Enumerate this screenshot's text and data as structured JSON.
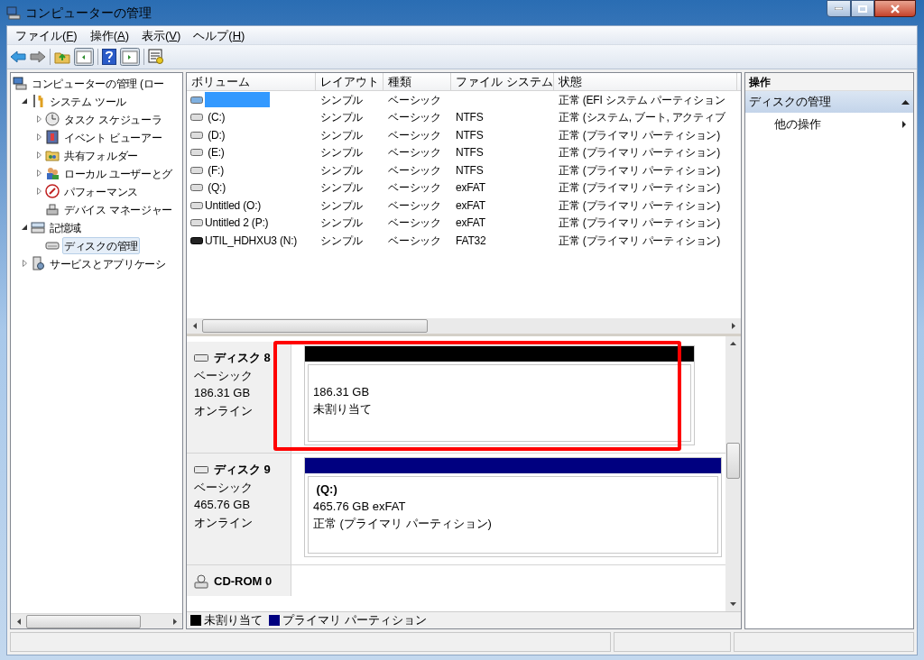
{
  "window": {
    "title": "コンピューターの管理"
  },
  "menu": [
    "ファイル(F)",
    "操作(A)",
    "表示(V)",
    "ヘルプ(H)"
  ],
  "tree": [
    {
      "label": "コンピューターの管理 (ロー",
      "selected": false,
      "children": [
        {
          "label": "システム ツール",
          "expanded": true,
          "selected": false,
          "children": [
            {
              "label": "タスク スケジューラ",
              "expanded": false,
              "selected": false
            },
            {
              "label": "イベント ビューアー",
              "expanded": false,
              "selected": false
            },
            {
              "label": "共有フォルダー",
              "expanded": false,
              "selected": false
            },
            {
              "label": "ローカル ユーザーとグ",
              "expanded": false,
              "selected": false
            },
            {
              "label": "パフォーマンス",
              "expanded": false,
              "selected": false
            },
            {
              "label": "デバイス マネージャー",
              "selected": false
            }
          ]
        },
        {
          "label": "記憶域",
          "expanded": true,
          "selected": false,
          "children": [
            {
              "label": "ディスクの管理",
              "selected": true
            }
          ]
        },
        {
          "label": "サービスとアプリケーシ",
          "expanded": false,
          "selected": false
        }
      ]
    }
  ],
  "table": {
    "columns": [
      "ボリューム",
      "レイアウト",
      "種類",
      "ファイル システム",
      "状態"
    ],
    "rows": [
      {
        "kind": "hidden",
        "selected": true,
        "layout": "シンプル",
        "type": "ベーシック",
        "status": "正常 (EFI システム パーティション"
      },
      {
        "kind": "disk",
        "selected": false,
        "volume": " (C:)",
        "layout": "シンプル",
        "type": "ベーシック",
        "fs": "NTFS",
        "status": "正常 (システム, ブート, アクティブ"
      },
      {
        "kind": "disk",
        "selected": false,
        "volume": " (D:)",
        "layout": "シンプル",
        "type": "ベーシック",
        "fs": "NTFS",
        "status": "正常 (プライマリ パーティション)"
      },
      {
        "kind": "disk",
        "selected": false,
        "volume": " (E:)",
        "layout": "シンプル",
        "type": "ベーシック",
        "fs": "NTFS",
        "status": "正常 (プライマリ パーティション)"
      },
      {
        "kind": "disk",
        "selected": false,
        "volume": " (F:)",
        "layout": "シンプル",
        "type": "ベーシック",
        "fs": "NTFS",
        "status": "正常 (プライマリ パーティション)"
      },
      {
        "kind": "disk",
        "selected": false,
        "volume": " (Q:)",
        "layout": "シンプル",
        "type": "ベーシック",
        "fs": "exFAT",
        "status": "正常 (プライマリ パーティション)"
      },
      {
        "kind": "disk",
        "selected": false,
        "volume": "Untitled (O:)",
        "layout": "シンプル",
        "type": "ベーシック",
        "fs": "exFAT",
        "status": "正常 (プライマリ パーティション)"
      },
      {
        "kind": "disk",
        "selected": false,
        "volume": "Untitled 2 (P:)",
        "layout": "シンプル",
        "type": "ベーシック",
        "fs": "exFAT",
        "status": "正常 (プライマリ パーティション)"
      },
      {
        "kind": "usb",
        "selected": false,
        "volume": "UTIL_HDHXU3 (N:)",
        "layout": "シンプル",
        "type": "ベーシック",
        "fs": "FAT32",
        "status": "正常 (プライマリ パーティション)"
      }
    ]
  },
  "disks": [
    {
      "kind": "disk",
      "name": "ディスク 8",
      "type": "ベーシック",
      "size": "186.31 GB",
      "status": "オンライン",
      "highlighted": true,
      "partition": {
        "color": "#000000",
        "lines": [
          "186.31 GB",
          "未割り当て"
        ]
      }
    },
    {
      "kind": "disk",
      "name": "ディスク 9",
      "type": "ベーシック",
      "size": "465.76 GB",
      "status": "オンライン",
      "highlighted": false,
      "partition": {
        "color": "#000080",
        "label": " (Q:)",
        "lines": [
          "465.76 GB exFAT",
          "正常 (プライマリ パーティション)"
        ]
      }
    },
    {
      "kind": "cdrom",
      "name": "CD-ROM 0",
      "highlighted": false
    }
  ],
  "legend": [
    {
      "label": "未割り当て",
      "color": "#000000"
    },
    {
      "label": "プライマリ パーティション",
      "color": "#000080"
    }
  ],
  "actions": {
    "title": "操作",
    "section": {
      "label": "ディスクの管理",
      "expanded": true
    },
    "items": [
      "他の操作"
    ]
  }
}
